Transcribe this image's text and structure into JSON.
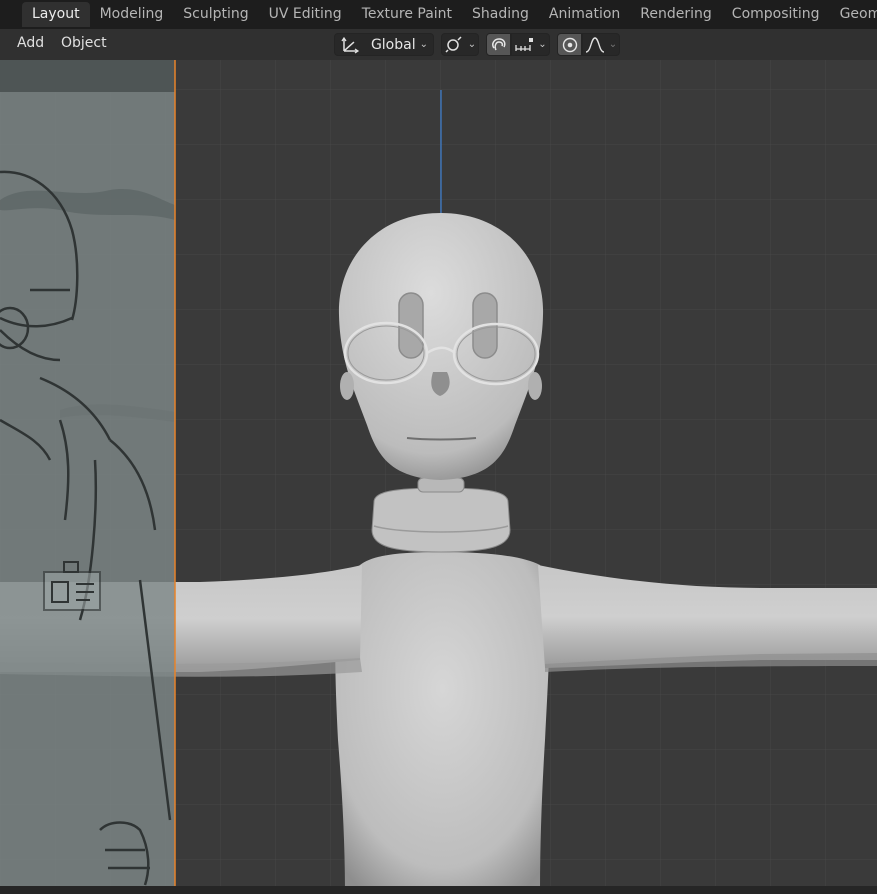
{
  "workspace_tabs": [
    "Layout",
    "Modeling",
    "Sculpting",
    "UV Editing",
    "Texture Paint",
    "Shading",
    "Animation",
    "Rendering",
    "Compositing",
    "Geome"
  ],
  "active_tab": "Layout",
  "header": {
    "menu": {
      "add": "Add",
      "object": "Object"
    },
    "transform_orientation": "Global",
    "icons": {
      "orientation": "transform-orientation-icon",
      "pivot": "pivot-point-icon",
      "snap": "snap-magnet-icon",
      "snap_increment": "snap-increment-icon",
      "proportional": "proportional-editing-icon",
      "falloff": "falloff-curve-icon"
    }
  },
  "colors": {
    "topbar": "#1d1d1d",
    "header": "#303030",
    "viewport": "#3a3a3a",
    "grid": "#494949",
    "z_axis": "#3d7cc9",
    "reference_edge": "#e8832a",
    "model_light": "#d1d1d1",
    "model_shadow": "#8c8c8c"
  },
  "viewport": {
    "objects": [
      "reference-image",
      "character-model"
    ]
  }
}
